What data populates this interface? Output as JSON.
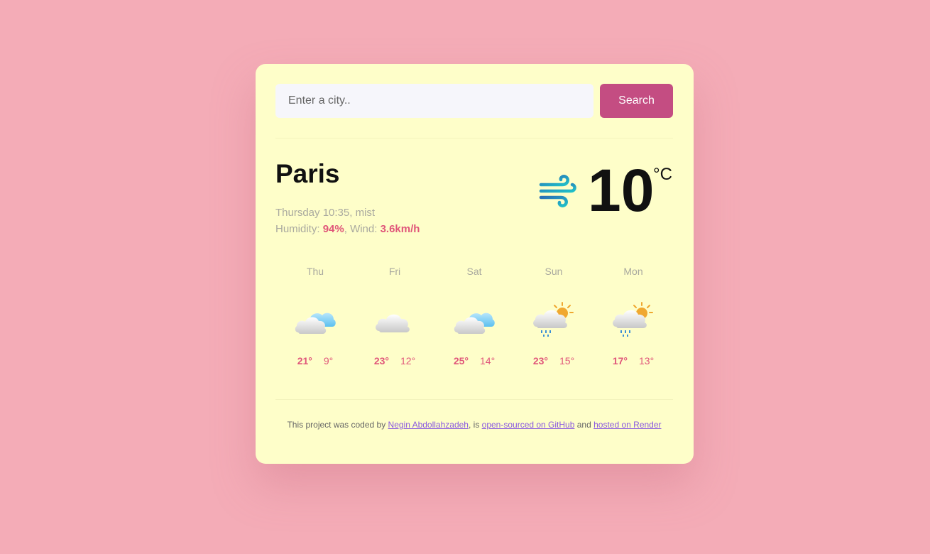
{
  "search": {
    "placeholder": "Enter a city..",
    "button_label": "Search"
  },
  "current": {
    "city": "Paris",
    "datetime": "Thursday 10:35",
    "description": "mist",
    "humidity_label": "Humidity: ",
    "humidity": "94%",
    "wind_label": "Wind: ",
    "wind": "3.6km/h",
    "icon": "wind-icon",
    "temperature": "10",
    "unit": "°C"
  },
  "forecast": [
    {
      "day": "Thu",
      "icon": "cloudy-blue-icon",
      "max": "21°",
      "min": "9°"
    },
    {
      "day": "Fri",
      "icon": "cloud-icon",
      "max": "23°",
      "min": "12°"
    },
    {
      "day": "Sat",
      "icon": "cloudy-blue-icon",
      "max": "25°",
      "min": "14°"
    },
    {
      "day": "Sun",
      "icon": "sun-rain-icon",
      "max": "23°",
      "min": "15°"
    },
    {
      "day": "Mon",
      "icon": "sun-rain-icon",
      "max": "17°",
      "min": "13°"
    }
  ],
  "footer": {
    "prefix": "This project was coded by ",
    "author_link": "Negin Abdollahzadeh",
    "mid1": ", is ",
    "github_link": "open-sourced on GitHub",
    "mid2": " and ",
    "hosting_link": "hosted on Render"
  },
  "colors": {
    "background": "#f4acb7",
    "card": "#fefec9",
    "button": "#c44d82",
    "accent": "#e0567a",
    "link": "#8a5ae0"
  }
}
